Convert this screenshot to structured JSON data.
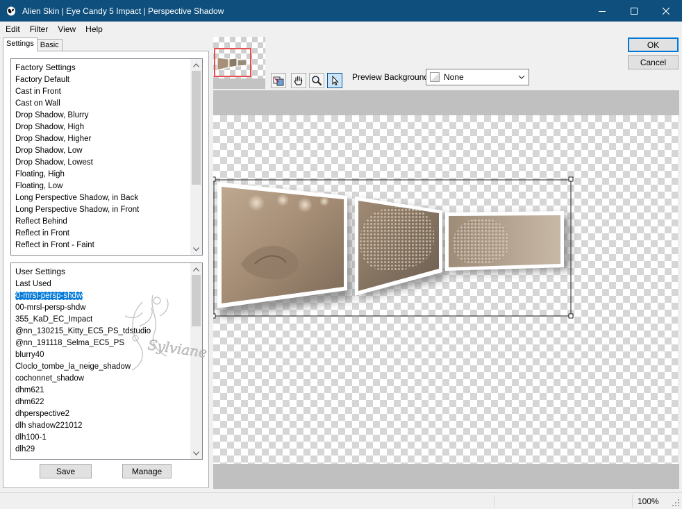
{
  "window": {
    "title": "Alien Skin | Eye Candy 5 Impact | Perspective Shadow"
  },
  "menu": [
    "Edit",
    "Filter",
    "View",
    "Help"
  ],
  "tabs": [
    "Settings",
    "Basic"
  ],
  "factory": {
    "header": "Factory Settings",
    "items": [
      "Factory Default",
      "Cast in Front",
      "Cast on Wall",
      "Drop Shadow, Blurry",
      "Drop Shadow, High",
      "Drop Shadow, Higher",
      "Drop Shadow, Low",
      "Drop Shadow, Lowest",
      "Floating, High",
      "Floating, Low",
      "Long Perspective Shadow, in Back",
      "Long Perspective Shadow, in Front",
      "Reflect Behind",
      "Reflect in Front",
      "Reflect in Front - Faint"
    ]
  },
  "user": {
    "header": "User Settings",
    "selected_index": 1,
    "items": [
      "Last Used",
      "0-mrsl-persp-shdw",
      "00-mrsl-persp-shdw",
      "355_KaD_EC_Impact",
      "@nn_130215_Kitty_EC5_PS_tdstudio",
      "@nn_191118_Selma_EC5_PS",
      "blurry40",
      "Cloclo_tombe_la_neige_shadow",
      "cochonnet_shadow",
      "dhm621",
      "dhm622",
      "dhperspective2",
      "dlh shadow221012",
      "dlh100-1",
      "dlh29"
    ]
  },
  "buttons": {
    "save": "Save",
    "manage": "Manage",
    "ok": "OK",
    "cancel": "Cancel"
  },
  "preview_background": {
    "label": "Preview Background:",
    "value": "None"
  },
  "tools": [
    "preview-toggle-icon",
    "hand-icon",
    "zoom-icon",
    "arrow-pointer-icon"
  ],
  "watermark_text": "Sylviane",
  "status": {
    "zoom": "100%"
  },
  "colors": {
    "titlebar": "#0e4f7d",
    "selection": "#0078d7",
    "thumbnail_border": "#e84d4d"
  }
}
